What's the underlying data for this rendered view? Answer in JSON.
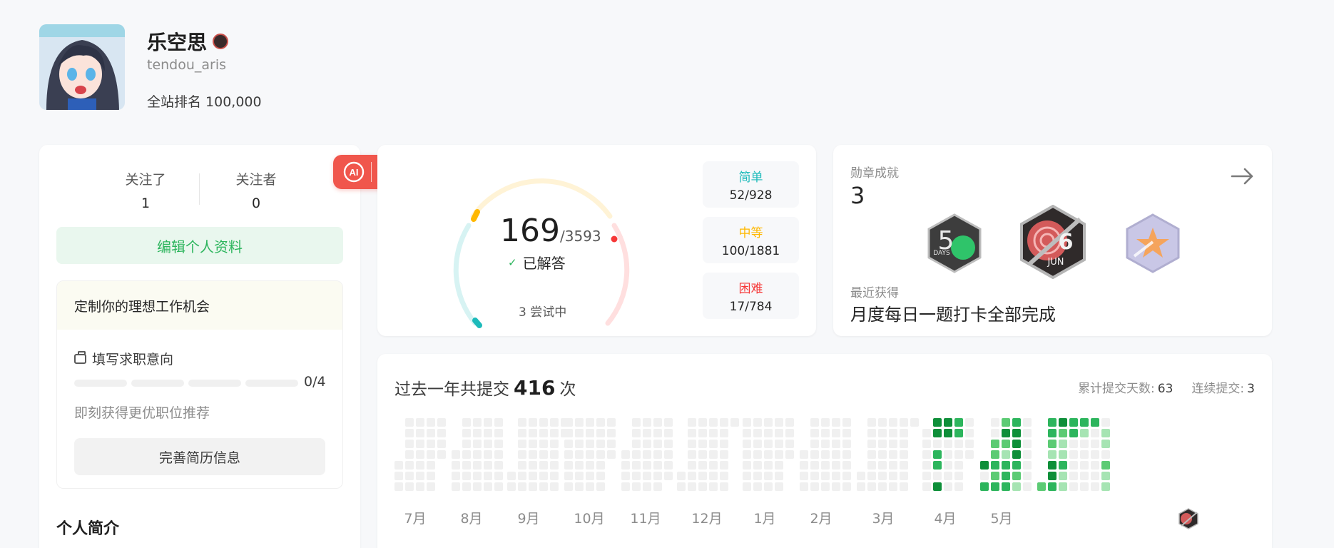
{
  "profile": {
    "name": "乐空思",
    "username": "tendou_aris",
    "rank_label": "全站排名",
    "rank_value": "100,000"
  },
  "social": {
    "following_label": "关注了",
    "following_value": "1",
    "followers_label": "关注者",
    "followers_value": "0",
    "edit_button": "编辑个人资料"
  },
  "job": {
    "header": "定制你的理想工作机会",
    "title": "填写求职意向",
    "progress": "0/4",
    "progress_fraction": 0,
    "subtitle": "即刻获得更优职位推荐",
    "button": "完善简历信息"
  },
  "bio": {
    "title": "个人简介"
  },
  "toolbar": {
    "items": [
      "ai-icon",
      "magic-wand-icon",
      "search-icon"
    ]
  },
  "solved": {
    "count": "169",
    "total": "/3593",
    "label": "已解答",
    "attempting": "3 尝试中",
    "easy": {
      "label": "简单",
      "value": "52/928",
      "color": "#1cbaba"
    },
    "medium": {
      "label": "中等",
      "value": "100/1881",
      "color": "#ffb800"
    },
    "hard": {
      "label": "困难",
      "value": "17/784",
      "color": "#f63737"
    }
  },
  "badges": {
    "label": "勋章成就",
    "count": "3",
    "recent_label": "最近获得",
    "recent_name": "月度每日一题打卡全部完成",
    "medal_1_text": "DAYS",
    "medal_1_digit": "5",
    "medal_2_text": "JUN",
    "medal_2_digit": "6"
  },
  "heatmap": {
    "title_prefix": "过去一年共提交",
    "count": "416",
    "title_suffix": "次",
    "total_days_label": "累计提交天数:",
    "total_days_value": "63",
    "streak_label": "连续提交:",
    "streak_value": "3",
    "months": [
      "7月",
      "8月",
      "9月",
      "10月",
      "11月",
      "12月",
      "1月",
      "2月",
      "3月",
      "4月",
      "5月"
    ],
    "colors": [
      "#f0f0f0",
      "#a6e4b3",
      "#5ccb74",
      "#2db55d",
      "#0e8f39"
    ]
  }
}
